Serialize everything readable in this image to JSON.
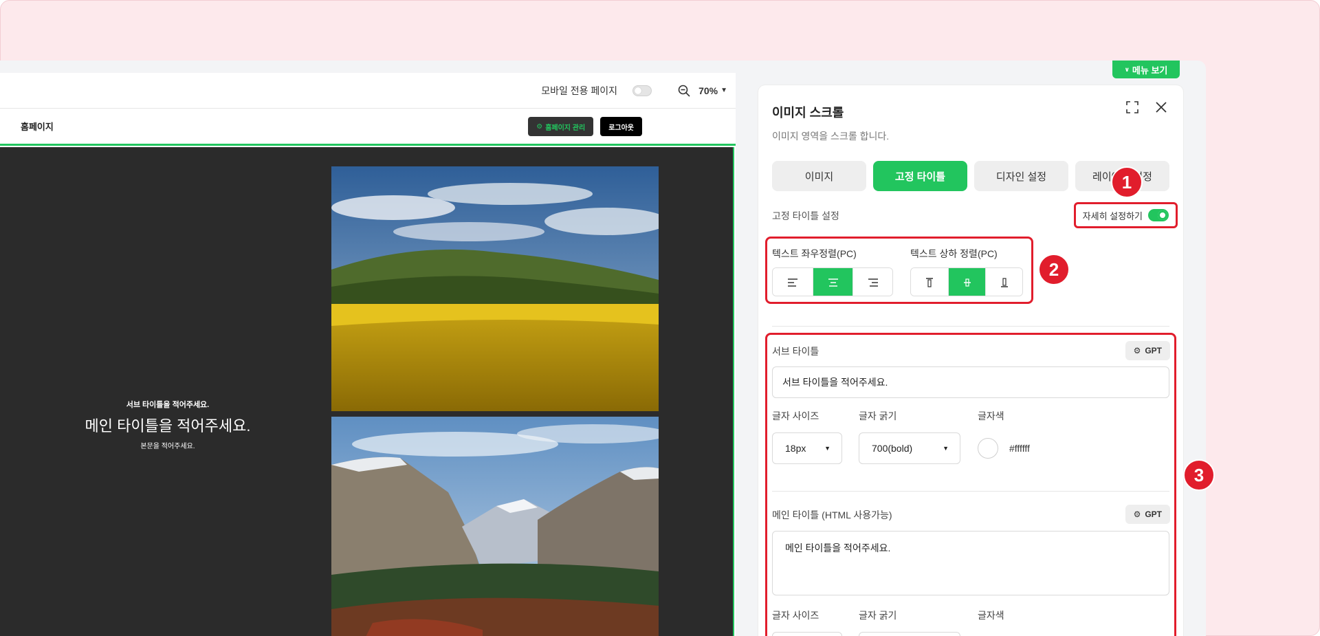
{
  "preview": {
    "mobile_only_label": "모바일 전용 페이지",
    "zoom_value": "70%",
    "site_title": "홈페이지",
    "manage_button": "홈페이지 관리",
    "logout_button": "로그아웃",
    "hero": {
      "sub_title": "서브 타이틀을 적어주세요.",
      "main_title": "메인 타이틀을 적어주세요.",
      "body_text": "본문을 적어주세요."
    }
  },
  "menu_tab_label": "메뉴 보기",
  "panel": {
    "title": "이미지 스크롤",
    "description": "이미지 영역을 스크롤 합니다.",
    "tabs": [
      {
        "label": "이미지",
        "active": false
      },
      {
        "label": "고정 타이틀",
        "active": true
      },
      {
        "label": "디자인 설정",
        "active": false
      },
      {
        "label": "레이아웃 설정",
        "active": false
      }
    ],
    "section_label": "고정 타이틀 설정",
    "detail_toggle_label": "자세히 설정하기",
    "align_h_label": "텍스트 좌우정렬(PC)",
    "align_v_label": "텍스트 상하 정렬(PC)",
    "sub_title_field": {
      "label": "서브 타이틀",
      "gpt_label": "GPT",
      "value": "서브 타이틀을 적어주세요.",
      "font_size_label": "글자 사이즈",
      "font_size_value": "18px",
      "font_weight_label": "글자 굵기",
      "font_weight_value": "700(bold)",
      "color_label": "글자색",
      "color_value": "#ffffff"
    },
    "main_title_field": {
      "label": "메인 타이틀 (HTML 사용가능)",
      "gpt_label": "GPT",
      "value": "메인 타이틀을 적어주세요.",
      "font_size_label": "글자 사이즈",
      "font_weight_label": "글자 굵기",
      "color_label": "글자색"
    }
  },
  "markers": [
    "1",
    "2",
    "3"
  ],
  "colors": {
    "accent": "#22c55e",
    "highlight": "#e11d2c"
  }
}
